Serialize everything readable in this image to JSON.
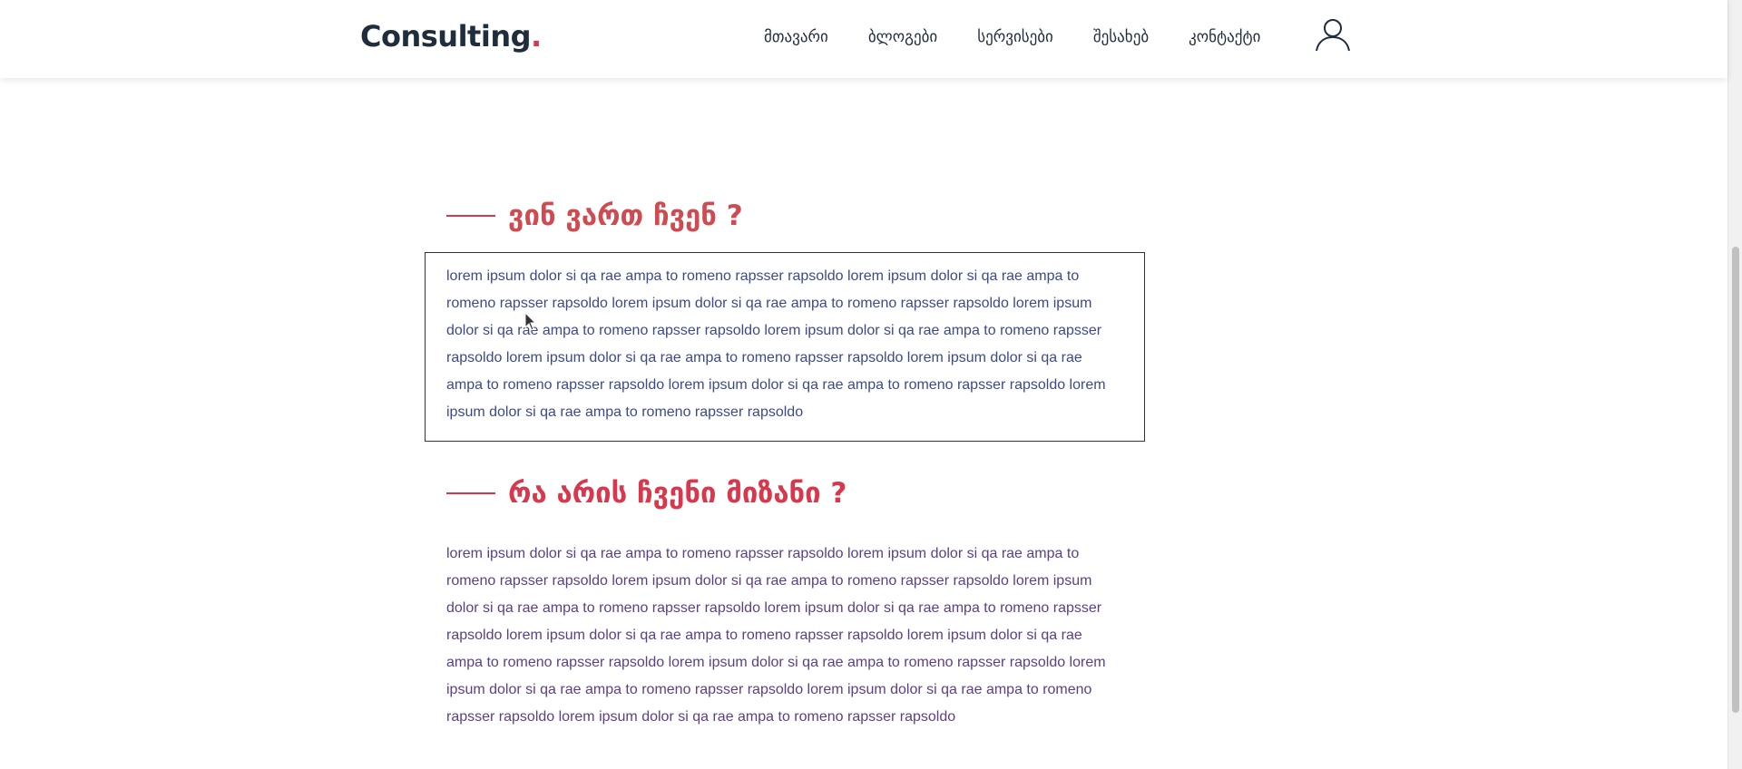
{
  "header": {
    "logo_text": "Consulting",
    "logo_dot": ".",
    "nav": [
      {
        "label": "მთავარი"
      },
      {
        "label": "ბლოგები"
      },
      {
        "label": "სერვისები"
      },
      {
        "label": "შესახებ"
      },
      {
        "label": "კონტაქტი"
      }
    ],
    "user_icon": "user-icon"
  },
  "about": {
    "title": "ვინ ვართ ჩვენ ?",
    "text": "lorem ipsum dolor si qa rae ampa to romeno rapsser rapsoldo lorem ipsum dolor si qa rae ampa to romeno rapsser rapsoldo lorem ipsum dolor si qa rae ampa to romeno rapsser rapsoldo lorem ipsum dolor si qa rae ampa to romeno rapsser rapsoldo lorem ipsum dolor si qa rae ampa to romeno rapsser rapsoldo lorem ipsum dolor si qa rae ampa to romeno rapsser rapsoldo lorem ipsum dolor si qa rae ampa to romeno rapsser rapsoldo lorem ipsum dolor si qa rae ampa to romeno rapsser rapsoldo lorem ipsum dolor si qa rae ampa to romeno rapsser rapsoldo"
  },
  "goal": {
    "title": "რა არის ჩვენი მიზანი ?",
    "text": "lorem ipsum dolor si qa rae ampa to romeno rapsser rapsoldo lorem ipsum dolor si qa rae ampa to romeno rapsser rapsoldo lorem ipsum dolor si qa rae ampa to romeno rapsser rapsoldo lorem ipsum dolor si qa rae ampa to romeno rapsser rapsoldo lorem ipsum dolor si qa rae ampa to romeno rapsser rapsoldo lorem ipsum dolor si qa rae ampa to romeno rapsser rapsoldo lorem ipsum dolor si qa rae ampa to romeno rapsser rapsoldo lorem ipsum dolor si qa rae ampa to romeno rapsser rapsoldo lorem ipsum dolor si qa rae ampa to romeno rapsser rapsoldo lorem ipsum dolor si qa rae ampa to romeno rapsser rapsoldo lorem ipsum dolor si qa rae ampa to romeno rapsser rapsoldo"
  },
  "colors": {
    "accent": "#d9374b",
    "dark": "#1f2d3d",
    "about_text": "#3c4a8c",
    "goal_text": "#5c3f86"
  }
}
